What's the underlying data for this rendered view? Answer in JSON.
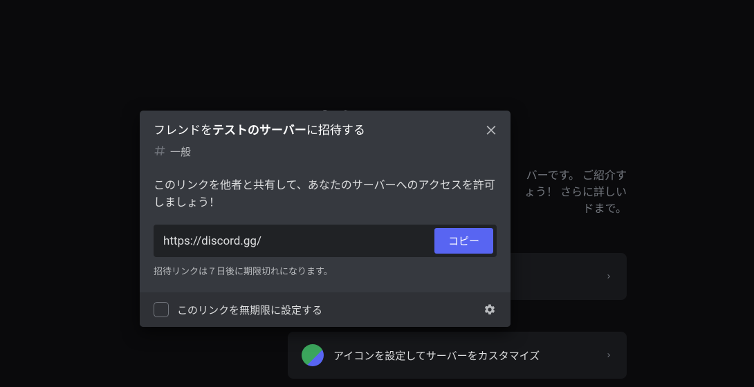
{
  "background": {
    "welcome_suffix": "へようこ",
    "desc_line1": "バーです。 ご紹介す",
    "desc_line2": "ょう！ さらに詳しい",
    "desc_line3": "ドまで。",
    "card2_label": "アイコンを設定してサーバーをカスタマイズ"
  },
  "modal": {
    "title_prefix": "フレンドを",
    "title_bold": "テストのサーバー",
    "title_suffix": "に招待する",
    "channel_name": "一般",
    "share_text": "このリンクを他者と共有して、あなたのサーバーへのアクセスを許可しましょう！",
    "invite_link": "https://discord.gg/",
    "copy_label": "コピー",
    "expiry_note": "招待リンクは７日後に期限切れになります。",
    "footer_checkbox_label": "このリンクを無期限に設定する"
  }
}
